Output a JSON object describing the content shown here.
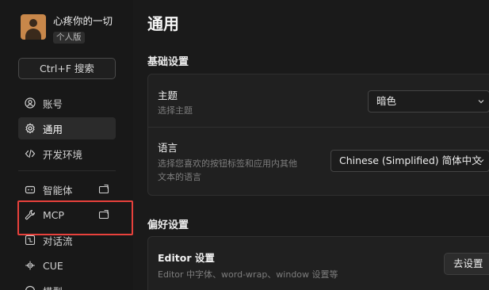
{
  "user": {
    "name": "心疼你的一切",
    "plan": "个人版"
  },
  "search": {
    "label": "Ctrl+F 搜索"
  },
  "nav": {
    "account": "账号",
    "general": "通用",
    "devenv": "开发环境",
    "agents": "智能体",
    "mcp": "MCP",
    "flows": "对话流",
    "cue": "CUE",
    "models": "模型"
  },
  "page": {
    "title": "通用"
  },
  "basic": {
    "title": "基础设置",
    "theme": {
      "label": "主题",
      "desc": "选择主题",
      "value": "暗色"
    },
    "language": {
      "label": "语言",
      "desc_line1": "选择您喜欢的按钮标签和应用内其他",
      "desc_line2": "文本的语言",
      "value": "Chinese (Simplified) 简体中文"
    }
  },
  "prefs": {
    "title": "偏好设置",
    "editor": {
      "label": "Editor 设置",
      "desc": "Editor 中字体、word-wrap、window 设置等",
      "button": "去设置"
    }
  },
  "colors": {
    "highlight": "#e8413c",
    "background": "#1a1a1a",
    "card": "#202020"
  },
  "icons": [
    "person-icon",
    "gear-icon",
    "code-icon",
    "robot-icon",
    "wrench-icon",
    "flow-icon",
    "cue-icon",
    "model-icon",
    "pin-icon",
    "chevron-down-icon"
  ]
}
